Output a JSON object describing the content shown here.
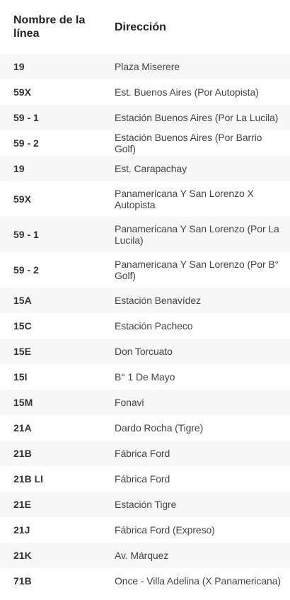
{
  "table": {
    "headers": {
      "line": "Nombre de la línea",
      "direction": "Dirección"
    },
    "rows": [
      {
        "line": "19",
        "direction": "Plaza Miserere"
      },
      {
        "line": "59X",
        "direction": "Est. Buenos Aires (Por Autopista)"
      },
      {
        "line": "59 - 1",
        "direction": "Estación Buenos Aires (Por La Lucila)"
      },
      {
        "line": "59 - 2",
        "direction": "Estación Buenos Aires (Por Barrio Golf)"
      },
      {
        "line": "19",
        "direction": "Est. Carapachay"
      },
      {
        "line": "59X",
        "direction": "Panamericana Y San Lorenzo X Autopista"
      },
      {
        "line": "59 - 1",
        "direction": "Panamericana Y San Lorenzo (Por La Lucila)"
      },
      {
        "line": "59 - 2",
        "direction": "Panamericana Y San Lorenzo (Por B° Golf)"
      },
      {
        "line": "15A",
        "direction": "Estación Benavídez"
      },
      {
        "line": "15C",
        "direction": "Estación Pacheco"
      },
      {
        "line": "15E",
        "direction": "Don Torcuato"
      },
      {
        "line": "15I",
        "direction": "B° 1 De Mayo"
      },
      {
        "line": "15M",
        "direction": "Fonavi"
      },
      {
        "line": "21A",
        "direction": "Dardo Rocha (Tigre)"
      },
      {
        "line": "21B",
        "direction": "Fábrica Ford"
      },
      {
        "line": "21B LI",
        "direction": "Fábrica Ford"
      },
      {
        "line": "21E",
        "direction": "Estación Tigre"
      },
      {
        "line": "21J",
        "direction": "Fábrica Ford (Expreso)"
      },
      {
        "line": "21K",
        "direction": "Av. Márquez"
      },
      {
        "line": "71B",
        "direction": "Once - Villa Adelina (X Panamericana)"
      }
    ]
  }
}
